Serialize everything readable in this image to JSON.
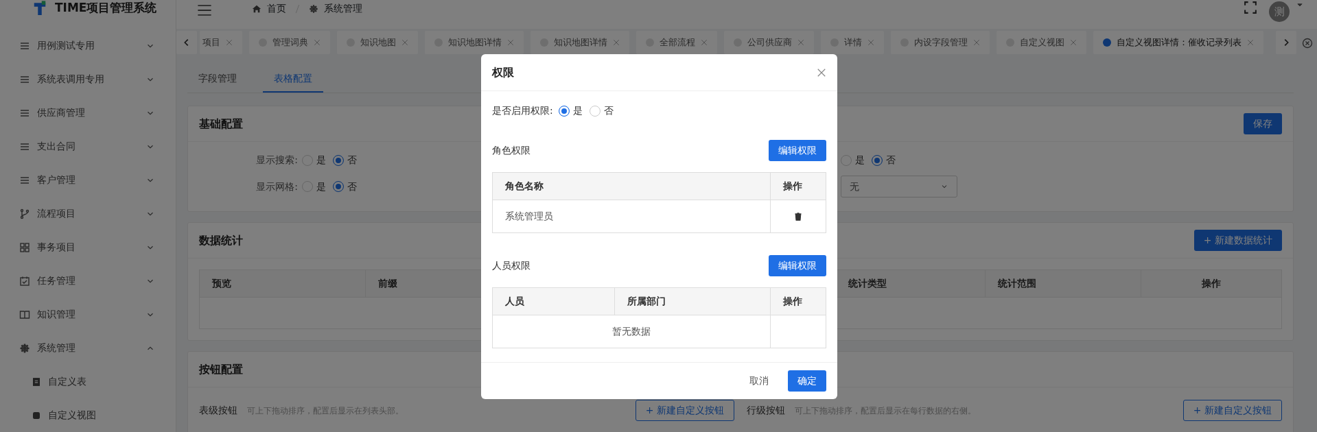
{
  "app": {
    "title": "TIME项目管理系统"
  },
  "sidebar": {
    "items": [
      {
        "label": "用例测试专用",
        "expanded": false
      },
      {
        "label": "系统表调用专用",
        "expanded": false
      },
      {
        "label": "供应商管理",
        "expanded": false
      },
      {
        "label": "支出合同",
        "expanded": false
      },
      {
        "label": "客户管理",
        "expanded": false
      },
      {
        "label": "流程项目",
        "expanded": false
      },
      {
        "label": "事务项目",
        "expanded": false
      },
      {
        "label": "任务管理",
        "expanded": false
      },
      {
        "label": "知识管理",
        "expanded": false
      },
      {
        "label": "系统管理",
        "expanded": true,
        "children": [
          {
            "label": "自定义表"
          },
          {
            "label": "自定义视图"
          }
        ]
      }
    ]
  },
  "breadcrumb": [
    "首页",
    "系统管理"
  ],
  "avatar": {
    "text": "测"
  },
  "tabs": [
    {
      "label": "项目",
      "selected": false
    },
    {
      "label": "管理词典",
      "selected": false
    },
    {
      "label": "知识地图",
      "selected": false
    },
    {
      "label": "知识地图详情",
      "selected": false
    },
    {
      "label": "知识地图详情",
      "selected": false
    },
    {
      "label": "全部流程",
      "selected": false
    },
    {
      "label": "公司供应商",
      "selected": false
    },
    {
      "label": "详情",
      "selected": false
    },
    {
      "label": "内设字段管理",
      "selected": false
    },
    {
      "label": "自定义视图",
      "selected": false
    },
    {
      "label": "自定义视图详情：催收记录列表",
      "selected": true
    }
  ],
  "subtabs": [
    {
      "label": "字段管理",
      "selected": false
    },
    {
      "label": "表格配置",
      "selected": true
    }
  ],
  "basic_config": {
    "title": "基础配置",
    "save": "保存",
    "rows": [
      [
        {
          "kind": "radio",
          "label": "显示搜索:",
          "options": [
            {
              "label": "是",
              "selected": false
            },
            {
              "label": "否",
              "selected": true
            }
          ]
        },
        {
          "kind": "radio",
          "options": [
            {
              "label": "是",
              "selected": false
            },
            {
              "label": "否",
              "selected": true
            }
          ]
        }
      ],
      [
        {
          "kind": "radio",
          "label": "显示网格:",
          "options": [
            {
              "label": "是",
              "selected": false
            },
            {
              "label": "否",
              "selected": true
            }
          ]
        },
        {
          "kind": "select",
          "value": "无"
        }
      ]
    ]
  },
  "data_stats": {
    "title": "数据统计",
    "add_button": "+ 新建数据统计",
    "columns": [
      "预览",
      "前缀",
      "统计类型",
      "统计范围",
      "操作"
    ]
  },
  "button_config": {
    "title": "按钮配置",
    "groups": [
      {
        "label": "表级按钮",
        "hint": "可上下拖动排序，配置后显示在列表头部。",
        "button": "+ 新建自定义按钮"
      },
      {
        "label": "行级按钮",
        "hint": "可上下拖动排序，配置后显示在每行数据的右侧。",
        "button": "+ 新建自定义按钮"
      }
    ]
  },
  "modal": {
    "title": "权限",
    "enable": {
      "label": "是否启用权限:",
      "options": [
        {
          "label": "是",
          "selected": true
        },
        {
          "label": "否",
          "selected": false
        }
      ]
    },
    "sections": [
      {
        "label": "角色权限",
        "button": "编辑权限",
        "columns": [
          "角色名称",
          "操作"
        ],
        "rows": [
          {
            "cells": [
              "系统管理员"
            ]
          }
        ]
      },
      {
        "label": "人员权限",
        "button": "编辑权限",
        "columns": [
          "人员",
          "所属部门",
          "操作"
        ],
        "empty_text": "暂无数据"
      }
    ],
    "cancel": "取消",
    "ok": "确定"
  }
}
